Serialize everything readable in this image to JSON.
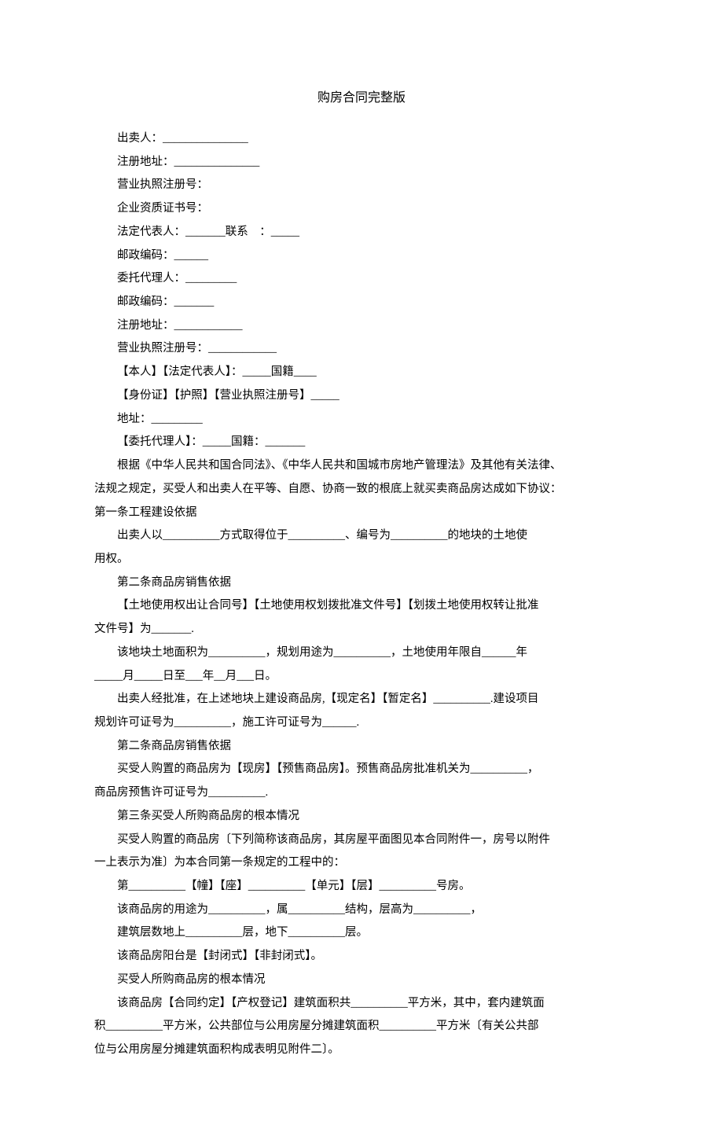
{
  "title": "购房合同完整版",
  "lines": [
    {
      "text": "出卖人：_______________",
      "indent": true
    },
    {
      "text": "注册地址：_______________",
      "indent": true
    },
    {
      "text": "营业执照注册号：",
      "indent": true
    },
    {
      "text": "企业资质证书号：",
      "indent": true
    },
    {
      "text": "法定代表人：_______联系    ：_____",
      "indent": true
    },
    {
      "text": "邮政编码：______",
      "indent": true
    },
    {
      "text": "委托代理人：_________",
      "indent": true
    },
    {
      "text": "邮政编码：_______",
      "indent": true
    },
    {
      "text": "注册地址：____________",
      "indent": true
    },
    {
      "text": "营业执照注册号：____________",
      "indent": true
    },
    {
      "text": "【本人】【法定代表人】：_____国籍____",
      "indent": true
    },
    {
      "text": "【身份证】【护照】【营业执照注册号】_____",
      "indent": true
    },
    {
      "text": "地址：_________",
      "indent": true
    },
    {
      "text": "【委托代理人】：_____国籍：_______",
      "indent": true
    },
    {
      "text": "根据《中华人民共和国合同法》、《中华人民共和国城市房地产管理法》及其他有关法律、",
      "indent": true
    },
    {
      "text": "法规之规定，买受人和出卖人在平等、自愿、协商一致的根底上就买卖商品房达成如下协议：",
      "indent": false
    },
    {
      "text": "第一条工程建设依据",
      "indent": false
    },
    {
      "text": "出卖人以__________方式取得位于__________、编号为__________的地块的土地使",
      "indent": true
    },
    {
      "text": "用权。",
      "indent": false
    },
    {
      "text": "第二条商品房销售依据",
      "indent": true
    },
    {
      "text": "【土地使用权出让合同号】【土地使用权划拨批准文件号】【划拨土地使用权转让批准",
      "indent": true
    },
    {
      "text": "文件号】为_______.",
      "indent": false
    },
    {
      "text": "该地块土地面积为__________，规划用途为__________，土地使用年限自______年",
      "indent": true
    },
    {
      "text": "_____月_____日至___年__月___日。",
      "indent": false
    },
    {
      "text": "出卖人经批准，在上述地块上建设商品房,【现定名】【暂定名】__________.建设项目",
      "indent": true
    },
    {
      "text": "规划许可证号为__________，施工许可证号为______.",
      "indent": false
    },
    {
      "text": "第二条商品房销售依据",
      "indent": true
    },
    {
      "text": "买受人购置的商品房为【现房】【预售商品房】。预售商品房批准机关为__________，",
      "indent": true
    },
    {
      "text": "商品房预售许可证号为__________.",
      "indent": false
    },
    {
      "text": "第三条买受人所购商品房的根本情况",
      "indent": true
    },
    {
      "text": "买受人购置的商品房〔下列简称该商品房，其房屋平面图见本合同附件一，房号以附件",
      "indent": true
    },
    {
      "text": "一上表示为准〕为本合同第一条规定的工程中的：",
      "indent": false
    },
    {
      "text": "第__________【幢】【座】__________【单元】【层】__________号房。",
      "indent": true
    },
    {
      "text": "该商品房的用途为__________，属__________结构，层高为__________，",
      "indent": true
    },
    {
      "text": "建筑层数地上__________层，地下__________层。",
      "indent": true
    },
    {
      "text": "该商品房阳台是【封闭式】【非封闭式】。",
      "indent": true
    },
    {
      "text": "买受人所购商品房的根本情况",
      "indent": true
    },
    {
      "text": "该商品房【合同约定】【产权登记】建筑面积共__________平方米，其中，套内建筑面",
      "indent": true
    },
    {
      "text": "积__________平方米，公共部位与公用房屋分摊建筑面积__________平方米〔有关公共部",
      "indent": false
    },
    {
      "text": "位与公用房屋分摊建筑面积构成表明见附件二〕。",
      "indent": false
    }
  ]
}
